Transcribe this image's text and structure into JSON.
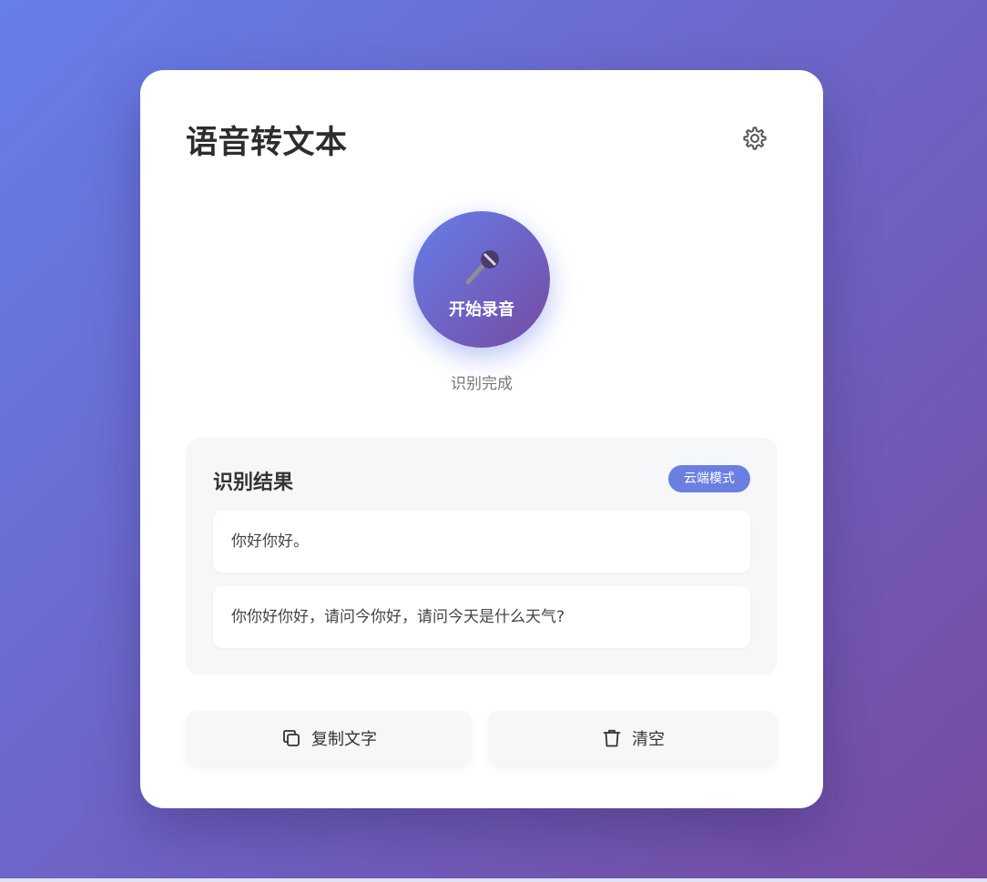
{
  "header": {
    "title": "语音转文本",
    "settings_icon": "gear-icon"
  },
  "recorder": {
    "button_label": "开始录音",
    "icon": "microphone-icon",
    "status": "识别完成"
  },
  "results": {
    "title": "识别结果",
    "mode_badge": "云端模式",
    "items": [
      "你好你好。",
      "你你好你好，请问今你好，请问今天是什么天气?"
    ]
  },
  "actions": {
    "copy_label": "复制文字",
    "copy_icon": "copy-icon",
    "clear_label": "清空",
    "clear_icon": "trash-icon"
  },
  "colors": {
    "gradient_start": "#667eea",
    "gradient_end": "#764ba2",
    "badge": "#6b7fe3"
  }
}
